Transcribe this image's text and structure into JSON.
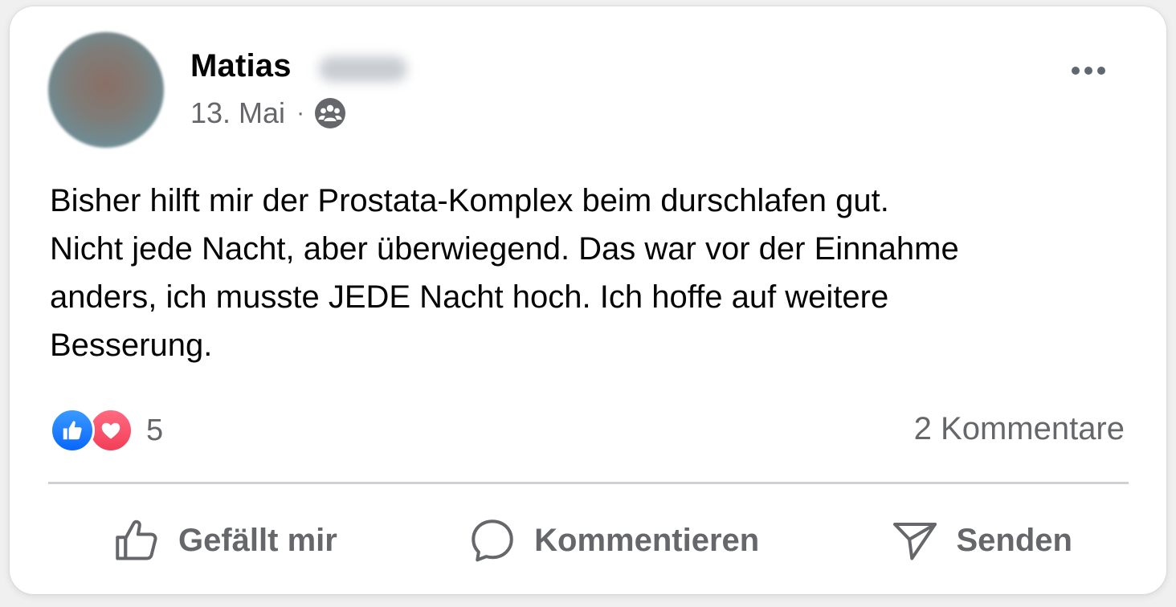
{
  "post": {
    "author": "Matias",
    "date": "13. Mai",
    "separator": "·",
    "audience_icon": "group-icon",
    "menu_icon": "more-horizontal-icon",
    "body": "Bisher hilft mir der Prostata-Komplex beim durschlafen gut.\nNicht jede Nacht, aber überwiegend. Das war vor der Einnahme\nanders, ich musste JEDE Nacht hoch. Ich hoffe auf weitere\nBesserung."
  },
  "engagement": {
    "reaction_icons": [
      "like-reaction-icon",
      "love-reaction-icon"
    ],
    "reaction_count": "5",
    "comments_label": "2 Kommentare"
  },
  "actions": {
    "like_label": "Gefällt mir",
    "comment_label": "Kommentieren",
    "send_label": "Senden"
  },
  "colors": {
    "like_blue": "#0866ff",
    "love_red": "#f33e58",
    "secondary_text": "#65676b",
    "divider": "#ced0d4"
  }
}
